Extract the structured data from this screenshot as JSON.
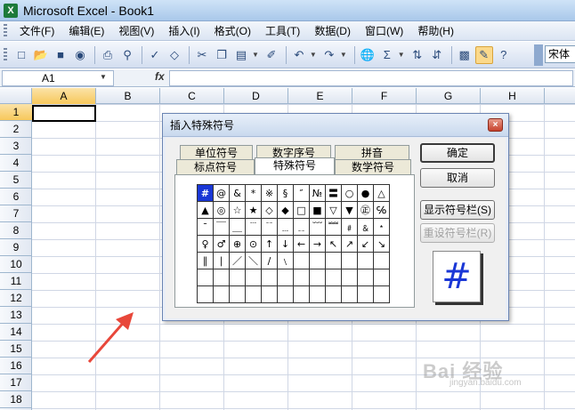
{
  "window": {
    "title": "Microsoft Excel - Book1",
    "app_icon": "X"
  },
  "menu": [
    "文件(F)",
    "编辑(E)",
    "视图(V)",
    "插入(I)",
    "格式(O)",
    "工具(T)",
    "数据(D)",
    "窗口(W)",
    "帮助(H)"
  ],
  "toolbar": {
    "icons": [
      "new-icon",
      "open-icon",
      "save-icon",
      "permission-icon",
      "print-icon",
      "print-preview-icon",
      "spelling-icon",
      "research-icon",
      "cut-icon",
      "copy-icon",
      "paste-icon",
      "format-painter-icon",
      "undo-icon",
      "redo-icon",
      "hyperlink-icon",
      "autosum-icon",
      "sort-asc-icon",
      "sort-desc-icon",
      "chart-wizard-icon",
      "drawing-icon",
      "help-icon"
    ],
    "font_name": "宋体",
    "autosum_symbol": "Σ"
  },
  "formula_bar": {
    "name_box": "A1",
    "fx_label": "fx",
    "formula": ""
  },
  "sheet": {
    "columns": [
      "A",
      "B",
      "C",
      "D",
      "E",
      "F",
      "G",
      "H"
    ],
    "rows": [
      "1",
      "2",
      "3",
      "4",
      "5",
      "6",
      "7",
      "8",
      "9",
      "10",
      "11",
      "12",
      "13",
      "14",
      "15",
      "16",
      "17",
      "18"
    ],
    "active_cell": "A1"
  },
  "dialog": {
    "title": "插入特殊符号",
    "close_label": "×",
    "tabs_back": [
      "单位符号",
      "数字序号",
      "拼音"
    ],
    "tabs_front": [
      "标点符号",
      "特殊符号",
      "数学符号"
    ],
    "active_tab": "特殊符号",
    "symbols": [
      [
        "#",
        "@",
        "&",
        "*",
        "※",
        "§",
        "″",
        "№",
        "〓",
        "○",
        "●",
        "△"
      ],
      [
        "▲",
        "◎",
        "☆",
        "★",
        "◇",
        "◆",
        "□",
        "■",
        "▽",
        "▼",
        "㊣",
        "℅"
      ],
      [
        "ˉ",
        "￣",
        "＿",
        "﹉",
        "﹊",
        "﹍",
        "﹎",
        "﹋",
        "﹌",
        "﹟",
        "﹠",
        "﹡"
      ],
      [
        "♀",
        "♂",
        "⊕",
        "⊙",
        "↑",
        "↓",
        "←",
        "→",
        "↖",
        "↗",
        "↙",
        "↘"
      ],
      [
        "∥",
        "∣",
        "／",
        "＼",
        "∕",
        "﹨",
        "",
        "",
        "",
        "",
        "",
        ""
      ],
      [
        "",
        "",
        "",
        "",
        "",
        "",
        "",
        "",
        "",
        "",
        "",
        ""
      ],
      [
        "",
        "",
        "",
        "",
        "",
        "",
        "",
        "",
        "",
        "",
        "",
        ""
      ]
    ],
    "selected_symbol": "#",
    "buttons": {
      "ok": "确定",
      "cancel": "取消",
      "show_toolbar": "显示符号栏(S)",
      "reset_toolbar": "重设符号栏(R)"
    },
    "preview": "#"
  },
  "watermark": {
    "text": "Bai 经验",
    "sub": "jingyan.baidu.com"
  },
  "colors": {
    "selection": "#1a37d6",
    "active_header": "#f7c85b",
    "arrow": "#e8473a"
  }
}
